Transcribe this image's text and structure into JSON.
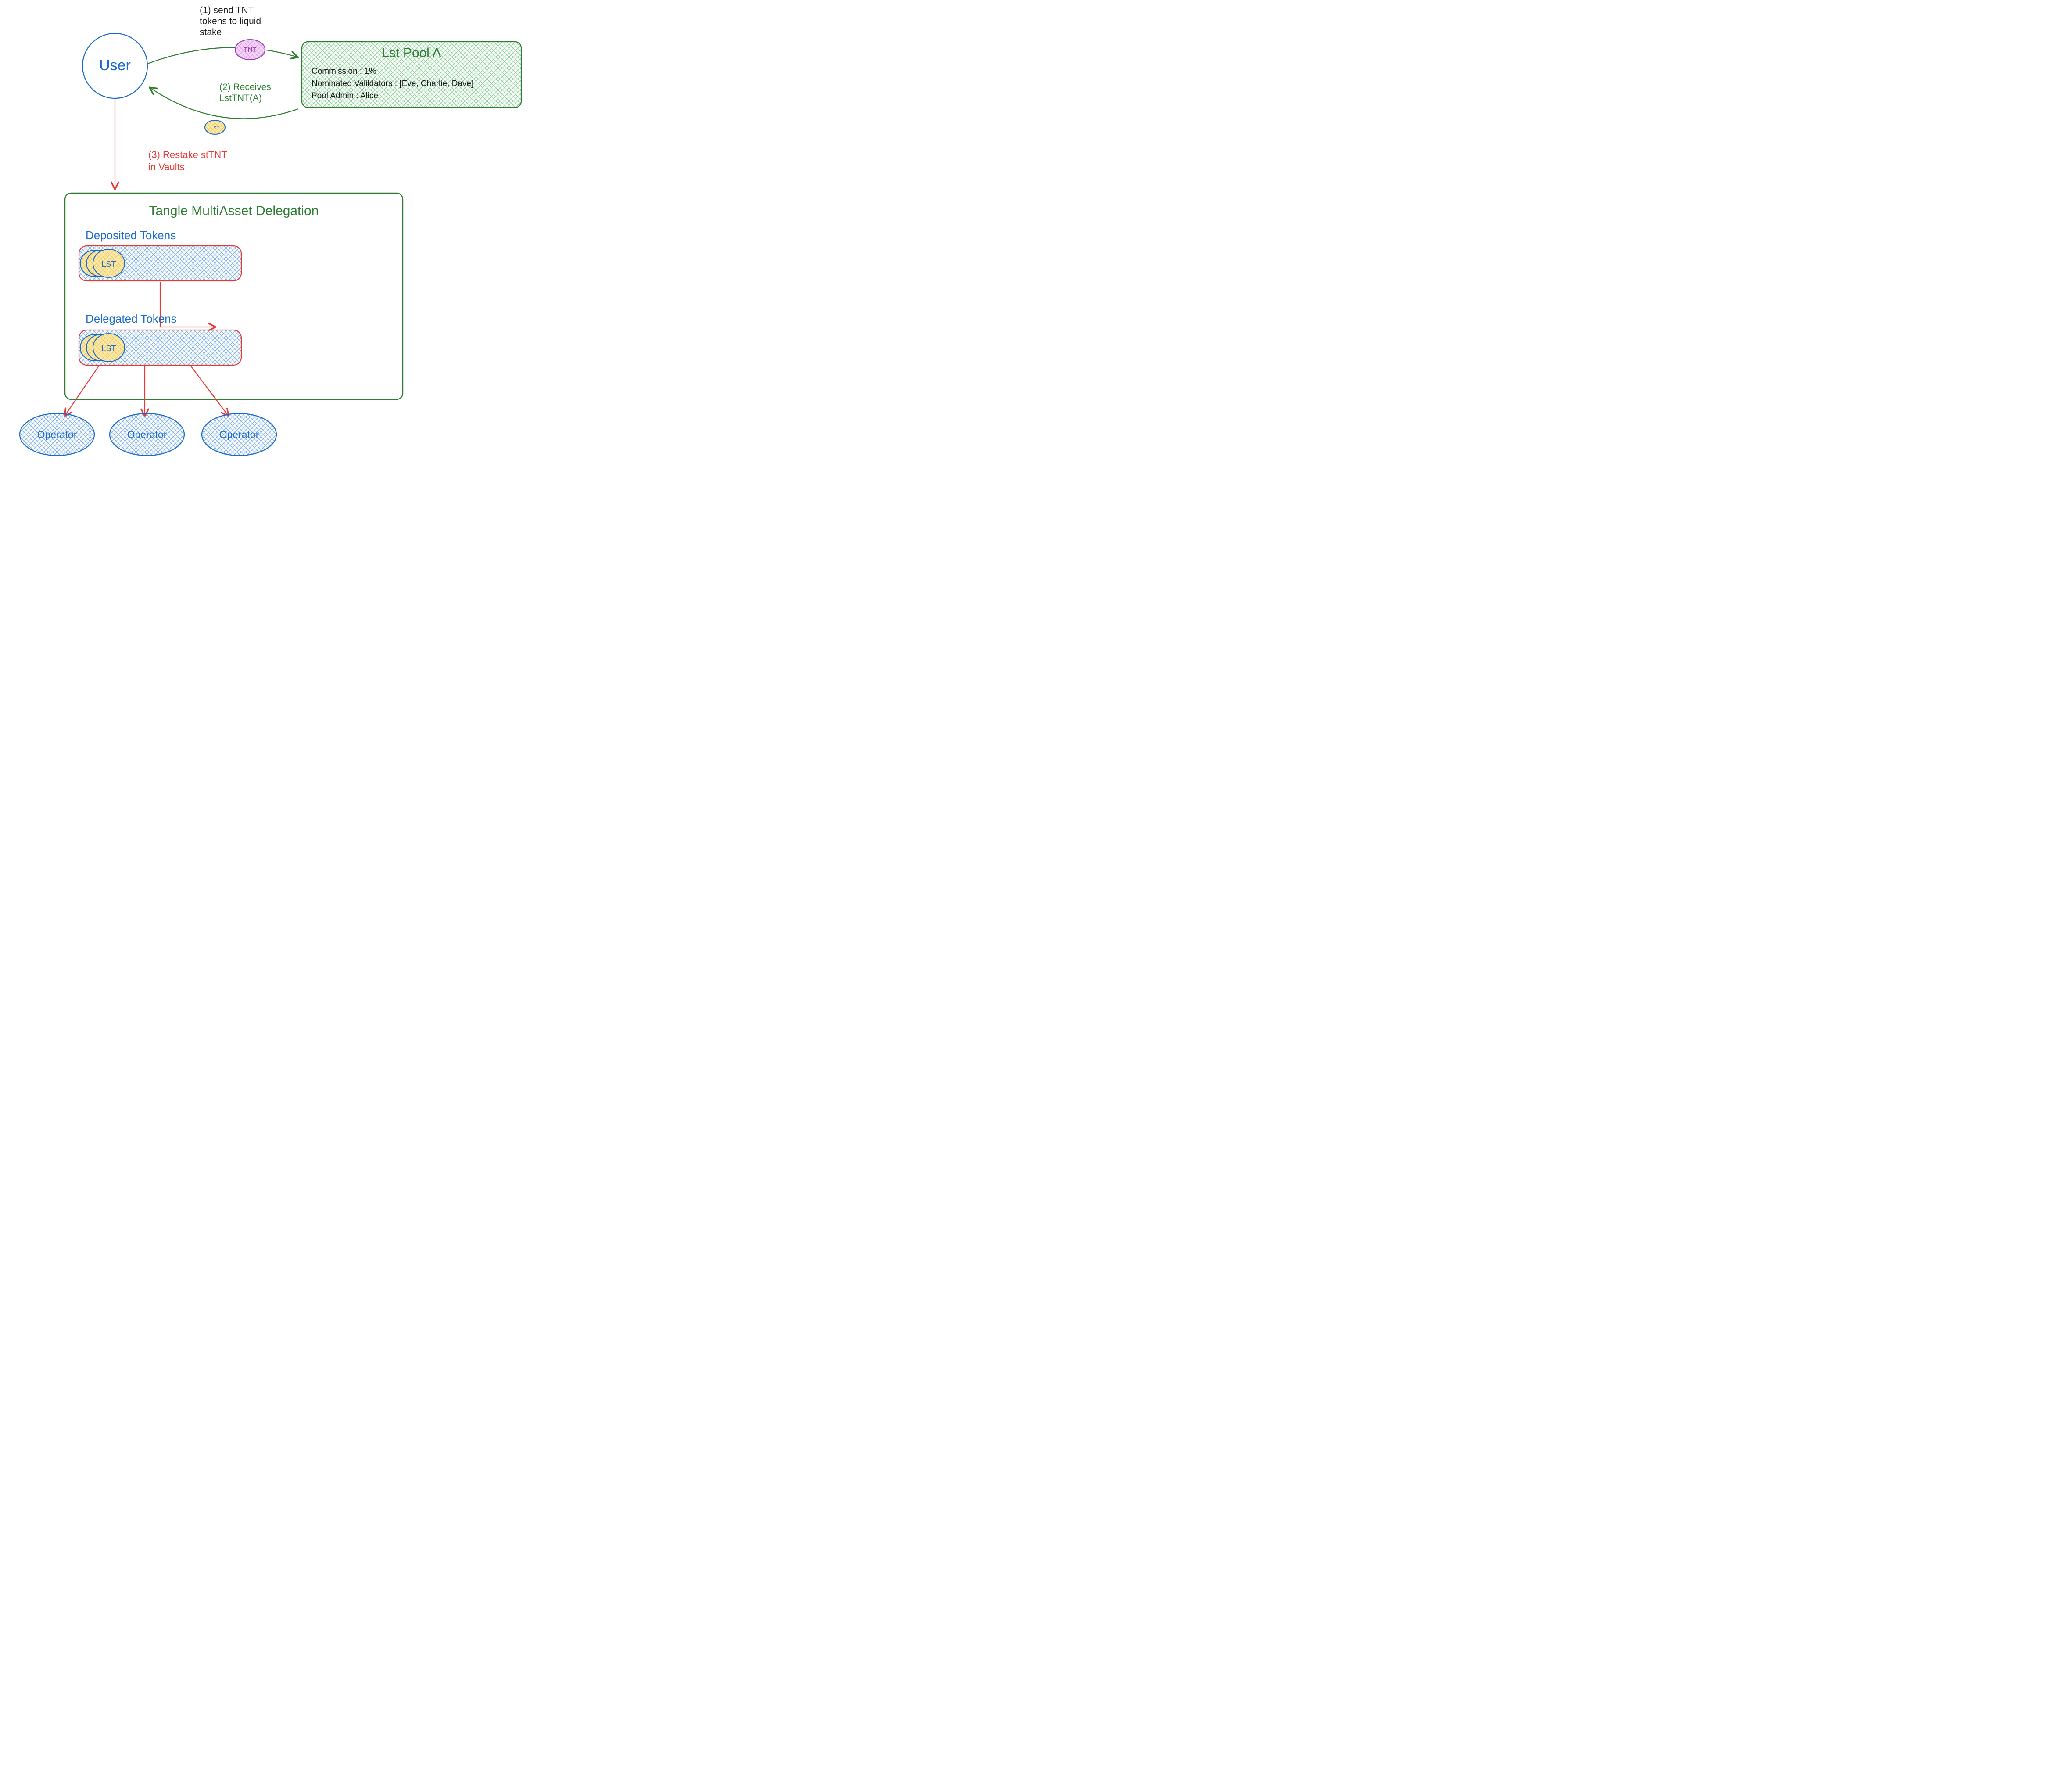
{
  "user": {
    "label": "User"
  },
  "step1": {
    "caption_l1": "(1) send TNT",
    "caption_l2": "tokens to liquid",
    "caption_l3": "stake",
    "token_label": "TNT"
  },
  "step2": {
    "caption_l1": "(2) Receives",
    "caption_l2": "LstTNT(A)",
    "token_label": "LST"
  },
  "step3": {
    "caption_l1": "(3) Restake stTNT",
    "caption_l2": "in Vaults"
  },
  "pool": {
    "title": "Lst Pool A",
    "commission_label": "Commission : 1%",
    "validators_label": "Nominated Valildators : [Eve, Charlie, Dave]",
    "admin_label": "Pool Admin : Alice"
  },
  "delegation": {
    "title": "Tangle MultiAsset Delegation",
    "deposited_label": "Deposited Tokens",
    "delegated_label": "Delegated Tokens",
    "deposited_token_label": "LST",
    "delegated_token_label": "LST"
  },
  "operators": {
    "op1_label": "Operator",
    "op2_label": "Operator",
    "op3_label": "Operator"
  }
}
